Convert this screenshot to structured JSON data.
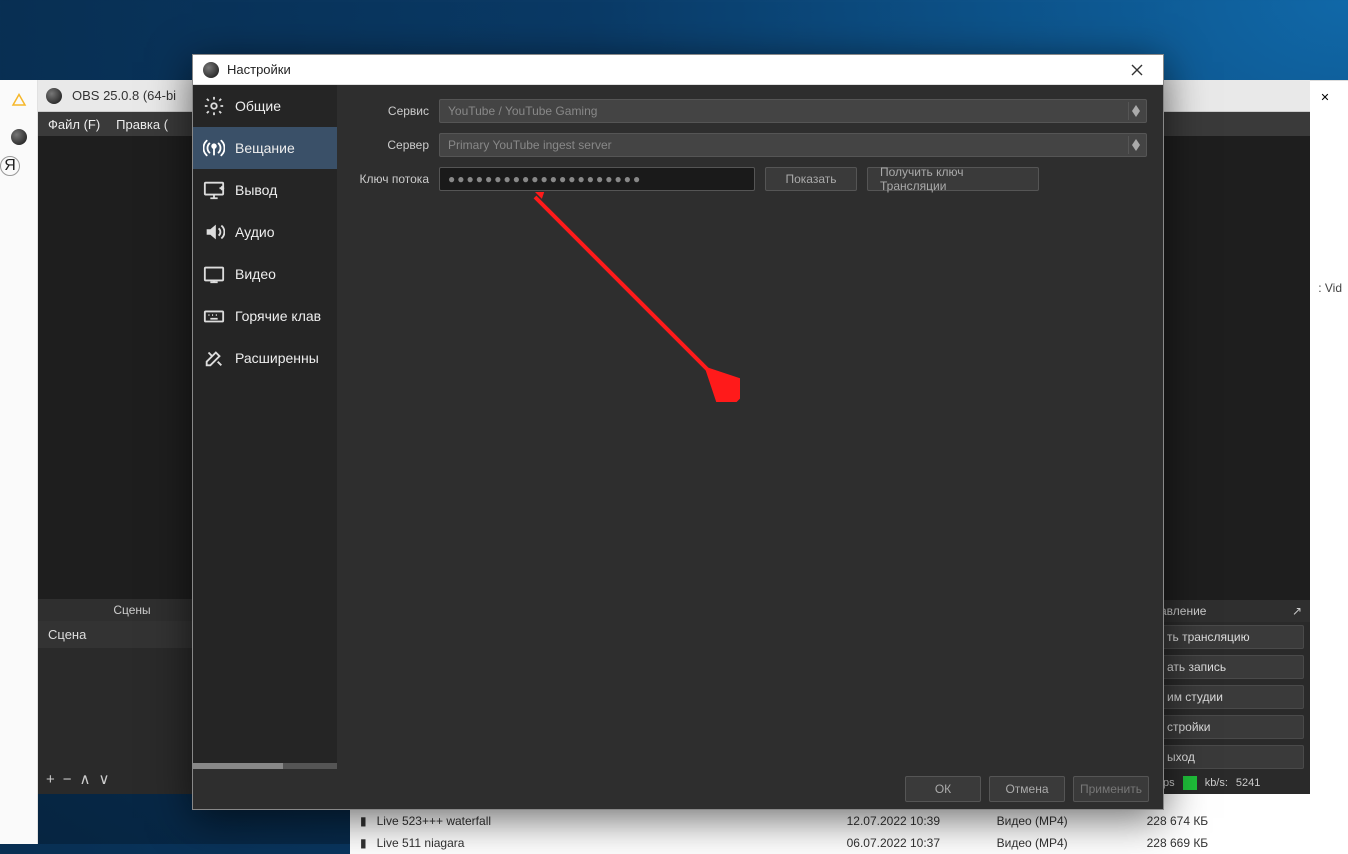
{
  "background_window": {
    "titlebar_buttons": [
      "min",
      "max",
      "close"
    ],
    "sidebar_tag_fragment": ": Vid",
    "files": [
      {
        "name": "Live 523+++ waterfall",
        "date": "12.07.2022 10:39",
        "type": "Видео (MP4)",
        "size": "228 674 КБ"
      },
      {
        "name": "Live 511 niagara",
        "date": "06.07.2022 10:37",
        "type": "Видео (MP4)",
        "size": "228 669 КБ"
      }
    ]
  },
  "taskbar": {
    "icons": [
      "drive-icon",
      "obs-icon",
      "yandex-icon"
    ]
  },
  "obs_main": {
    "tab_label": "OBS 25.0.8 (64-bi",
    "menu": {
      "file": "Файл (F)",
      "edit": "Правка ("
    },
    "scenes": {
      "header": "Сцены",
      "items": [
        "Сцена"
      ],
      "toolbar": [
        "+",
        "−",
        "∧",
        "∨"
      ]
    },
    "controls": {
      "header": "авление",
      "pop_icon": "↗",
      "buttons": [
        "ть трансляцию",
        "ать запись",
        "им студии",
        "стройки",
        "ыход"
      ],
      "status": {
        "fps_label": "fps",
        "kbs_label": "kb/s:",
        "kbs_value": "5241"
      }
    }
  },
  "settings": {
    "title": "Настройки",
    "sidebar": {
      "items": [
        {
          "icon": "gear-icon",
          "label": "Общие"
        },
        {
          "icon": "broadcast-icon",
          "label": "Вещание",
          "active": true
        },
        {
          "icon": "monitor-icon",
          "label": "Вывод"
        },
        {
          "icon": "speaker-icon",
          "label": "Аудио"
        },
        {
          "icon": "video-icon",
          "label": "Видео"
        },
        {
          "icon": "keyboard-icon",
          "label": "Горячие клав"
        },
        {
          "icon": "tools-icon",
          "label": "Расширенны"
        }
      ]
    },
    "form": {
      "service": {
        "label": "Сервис",
        "value": "YouTube / YouTube Gaming"
      },
      "server": {
        "label": "Сервер",
        "value": "Primary YouTube ingest server"
      },
      "streamkey": {
        "label": "Ключ потока",
        "value": "●●●●●●●●●●●●●●●●●●●●●",
        "show_btn": "Показать",
        "get_key_btn": "Получить ключ Трансляции"
      }
    },
    "footer": {
      "ok": "ОК",
      "cancel": "Отмена",
      "apply": "Применить"
    }
  }
}
